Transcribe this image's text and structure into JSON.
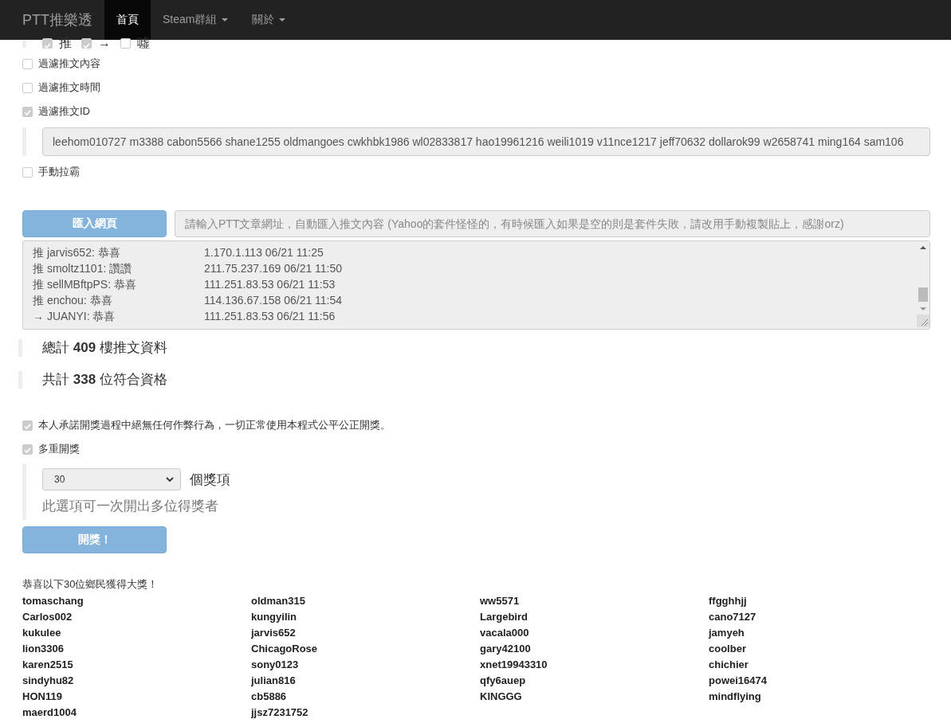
{
  "navbar": {
    "brand": "PTT推樂透",
    "items": [
      {
        "label": "首頁",
        "selected": true,
        "dropdown": false
      },
      {
        "label": "Steam群組",
        "selected": false,
        "dropdown": true
      },
      {
        "label": "關於",
        "selected": false,
        "dropdown": true
      }
    ]
  },
  "push_types": [
    {
      "label": "推",
      "checked": true
    },
    {
      "label": "→",
      "checked": true
    },
    {
      "label": "噓",
      "checked": false
    }
  ],
  "filter_content": {
    "label": "過濾推文內容",
    "checked": false
  },
  "filter_time": {
    "label": "過濾推文時間",
    "checked": false
  },
  "filter_id": {
    "label": "過濾推文ID",
    "checked": true,
    "value": "leehom010727 m3388 cabon5566 shane1255 oldmangoes cwkhbk1986 wl02833817 hao19961216 weili1019 v11nce1217 jeff70632 dollarok99 w2658741 ming164 sam106"
  },
  "manual_slot": {
    "label": "手動拉霸",
    "checked": false
  },
  "import": {
    "button": "匯入網頁",
    "placeholder": "請輸入PTT文章網址，自動匯入推文內容 (Yahoo的套件怪怪的，有時候匯入如果是空的則是套件失敗，請改用手動複製貼上，感謝orz)"
  },
  "comments": [
    {
      "text": "推 jarvis652: 恭喜",
      "meta": "1.170.1.113 06/21 11:25"
    },
    {
      "text": "推 smoltz1101: 讚讚",
      "meta": "211.75.237.169 06/21 11:50"
    },
    {
      "text": "推 sellMBftpPS: 恭喜",
      "meta": "111.251.83.53 06/21 11:53"
    },
    {
      "text": "推 enchou: 恭喜",
      "meta": "114.136.67.158 06/21 11:54"
    },
    {
      "text": "→ JUANYI: 恭喜",
      "meta": "111.251.83.53 06/21 11:56"
    }
  ],
  "stats": [
    "總計 **409** 樓推文資料",
    "共計 **338** 位符合資格"
  ],
  "pledge": {
    "label": "本人承諾開獎過程中絕無任何作弊行為，一切正常使用本程式公平公正開獎。",
    "checked": true
  },
  "multi_draw": {
    "label": "多重開獎",
    "checked": true,
    "count": "30",
    "unit": "個獎項",
    "hint": "此選項可一次開出多位得獎者"
  },
  "draw_button": "開獎！",
  "winners_title": "恭喜以下30位鄉民獲得大獎！",
  "winners": [
    [
      "tomaschang",
      "Carlos002",
      "kukulee",
      "lion3306",
      "karen2515",
      "sindyhu82",
      "HON119",
      "maerd1004"
    ],
    [
      "oldman315",
      "kungyilin",
      "jarvis652",
      "ChicagoRose",
      "sony0123",
      "julian816",
      "cb5886",
      "jjsz7231752"
    ],
    [
      "ww5571",
      "Largebird",
      "vacala000",
      "gary42100",
      "xnet19943310",
      "qfy6auep",
      "KINGGG"
    ],
    [
      "ffgghhjj",
      "cano7127",
      "jamyeh",
      "coolber",
      "chichier",
      "powei16474",
      "mindflying"
    ]
  ]
}
